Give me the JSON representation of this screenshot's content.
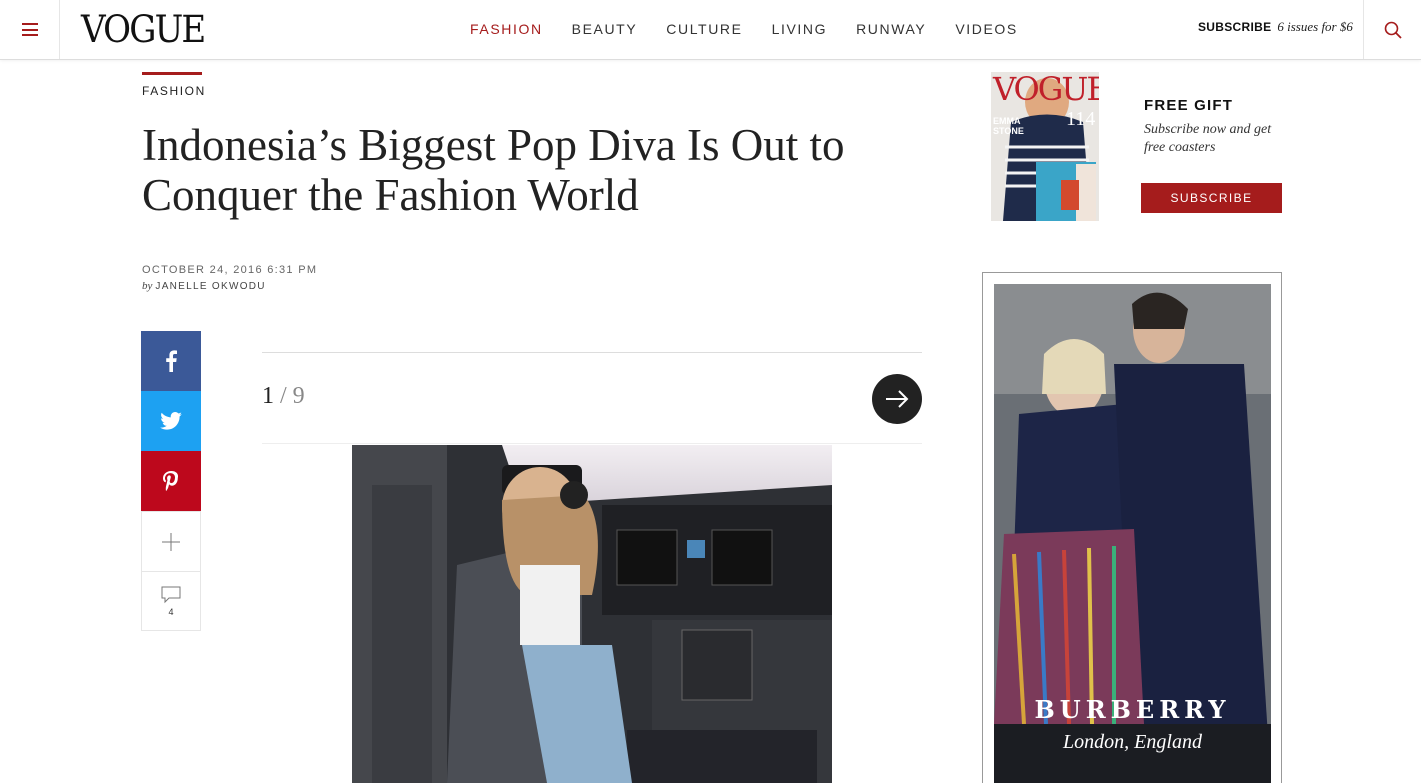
{
  "header": {
    "logo": "VOGUE",
    "nav": [
      {
        "label": "FASHION",
        "active": true
      },
      {
        "label": "BEAUTY",
        "active": false
      },
      {
        "label": "CULTURE",
        "active": false
      },
      {
        "label": "LIVING",
        "active": false
      },
      {
        "label": "RUNWAY",
        "active": false
      },
      {
        "label": "VIDEOS",
        "active": false
      }
    ],
    "subscribe_label": "SUBSCRIBE",
    "subscribe_offer": "6 issues for $6"
  },
  "article": {
    "kicker": "FASHION",
    "headline": "Indonesia’s Biggest Pop Diva Is Out to Conquer the Fashion World",
    "date": "OCTOBER 24, 2016 6:31 PM",
    "by": "by",
    "author": "JANELLE OKWODU"
  },
  "share": {
    "comment_count": "4"
  },
  "gallery": {
    "current": "1",
    "separator": "/",
    "total": "9"
  },
  "promo": {
    "title": "FREE GIFT",
    "copy": "Subscribe now and get free coasters",
    "button": "SUBSCRIBE",
    "cover_logo": "VOGUE",
    "cover_name": "EMMA STONE",
    "cover_number": "114"
  },
  "ad": {
    "brand": "BURBERRY",
    "place": "London, England"
  },
  "colors": {
    "accent": "#a51c1c",
    "facebook": "#3b5998",
    "twitter": "#1da1f2",
    "pinterest": "#bd081c"
  }
}
